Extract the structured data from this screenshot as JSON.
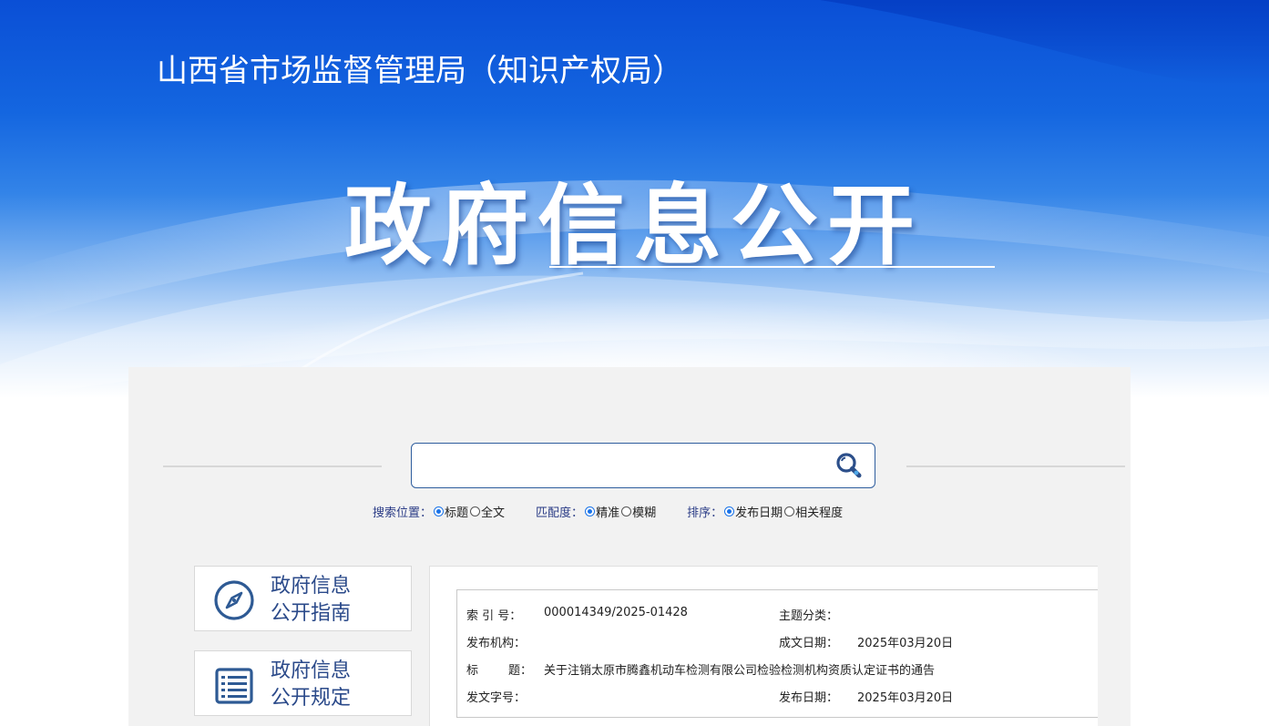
{
  "header": {
    "department": "山西省市场监督管理局（知识产权局）",
    "title": "政府信息公开"
  },
  "search": {
    "placeholder": "",
    "value": "",
    "icon": "search-icon"
  },
  "options": {
    "position_label": "搜索位置：",
    "position_choices": [
      {
        "label": "标题",
        "checked": true
      },
      {
        "label": "全文",
        "checked": false
      }
    ],
    "match_label": "匹配度：",
    "match_choices": [
      {
        "label": "精准",
        "checked": true
      },
      {
        "label": "模糊",
        "checked": false
      }
    ],
    "sort_label": "排序：",
    "sort_choices": [
      {
        "label": "发布日期",
        "checked": true
      },
      {
        "label": "相关程度",
        "checked": false
      }
    ]
  },
  "sidebar": {
    "items": [
      {
        "line1": "政府信息",
        "line2": "公开指南",
        "icon": "compass-icon"
      },
      {
        "line1": "政府信息",
        "line2": "公开规定",
        "icon": "document-list-icon"
      }
    ]
  },
  "meta": {
    "index_label": "索  引  号：",
    "index_value": "000014349/2025-01428",
    "topic_label": "主题分类：",
    "topic_value": "",
    "issuer_label": "发布机构：",
    "issuer_value": "",
    "created_label": "成文日期：",
    "created_value": "2025年03月20日",
    "title_label": "标        题：",
    "title_value": "关于注销太原市腾鑫机动车检测有限公司检验检测机构资质认定证书的通告",
    "docno_label": "发文字号：",
    "docno_value": "",
    "published_label": "发布日期：",
    "published_value": "2025年03月20日"
  },
  "colors": {
    "banner_blue": "#0a4fd6",
    "label_blue": "#2b3c86",
    "card_text": "#2b4a8a",
    "radio_checked": "#1a73e8"
  }
}
